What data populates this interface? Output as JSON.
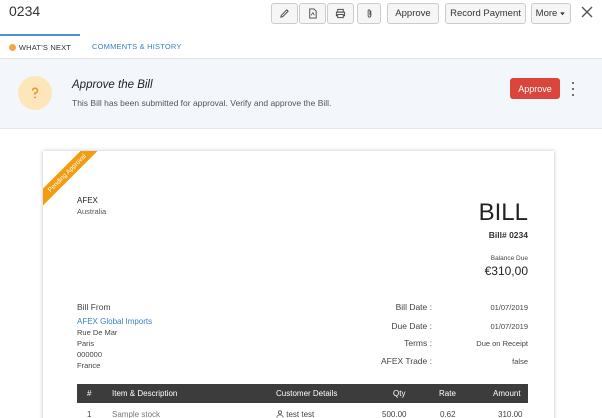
{
  "header": {
    "doc_number": "0234",
    "buttons": {
      "approve": "Approve",
      "record_payment": "Record Payment",
      "more": "More"
    },
    "icons": [
      "edit-icon",
      "pdf-icon",
      "print-icon",
      "attachment-icon",
      "close-icon",
      "caret-down-icon"
    ]
  },
  "tabs": [
    {
      "label": "WHAT'S NEXT",
      "active": true
    },
    {
      "label": "COMMENTS & HISTORY",
      "active": false
    }
  ],
  "banner": {
    "title": "Approve the Bill",
    "subtitle": "This Bill has been submitted for approval. Verify and approve the Bill.",
    "approve_label": "Approve",
    "icon": "question-icon"
  },
  "bill": {
    "ribbon": "Pending Approval",
    "org_name": "AFEX",
    "org_country": "Australia",
    "heading": "BILL",
    "bill_number": "Bill# 0234",
    "balance_label": "Balance Due",
    "balance_value": "€310,00",
    "bill_from_label": "Bill From",
    "vendor_name": "AFEX Global Imports",
    "vendor_address": [
      "Rue De Mar",
      "Paris",
      "000000",
      "France"
    ],
    "meta": [
      {
        "label": "Bill Date :",
        "value": "01/07/2019"
      },
      {
        "label": "Due Date :",
        "value": "01/07/2019"
      },
      {
        "label": "Terms :",
        "value": "Due on Receipt"
      },
      {
        "label": "AFEX Trade :",
        "value": "false"
      }
    ],
    "table": {
      "headers": [
        "#",
        "Item & Description",
        "Customer Details",
        "Qty",
        "Rate",
        "Amount"
      ],
      "rows": [
        [
          "1",
          "Sample stock",
          "test test",
          "500.00",
          "0.62",
          "310.00"
        ]
      ]
    }
  },
  "colors": {
    "accent": "#4b91d6",
    "approve": "#d9463b",
    "ribbon": "#f39c12",
    "banner_bg": "#f3f7fc",
    "link": "#3b7fc4"
  }
}
